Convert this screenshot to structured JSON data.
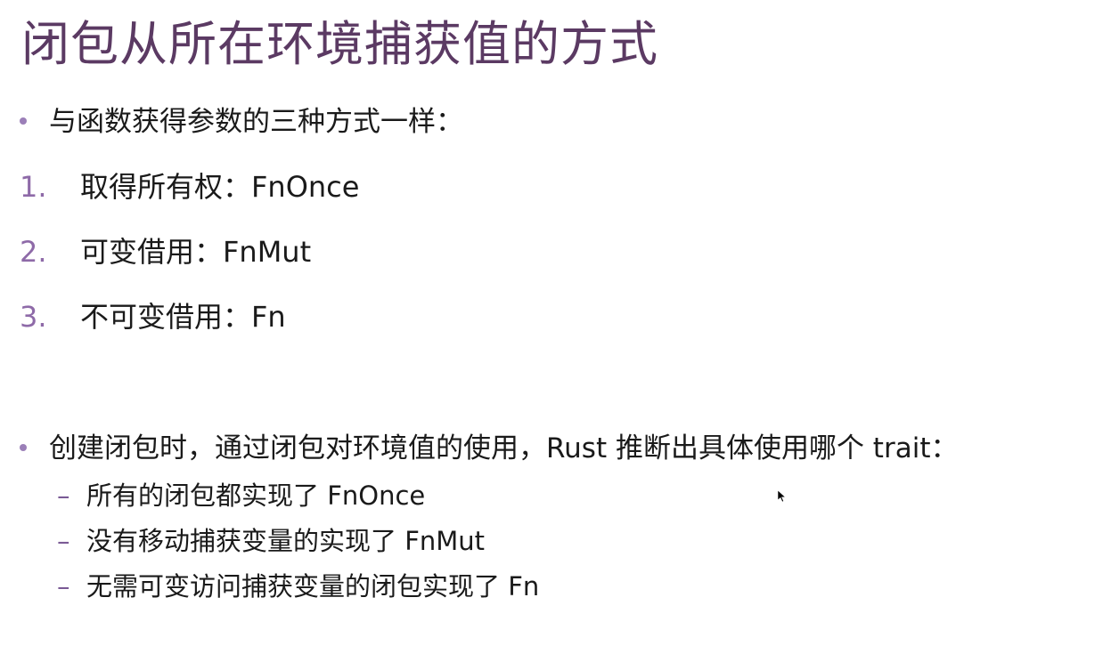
{
  "slide": {
    "title": "闭包从所在环境捕获值的方式",
    "intro_bullet": "与函数获得参数的三种方式一样：",
    "numbered_items": [
      {
        "number": "1.",
        "text": "取得所有权：FnOnce"
      },
      {
        "number": "2.",
        "text": "可变借用：FnMut"
      },
      {
        "number": "3.",
        "text": "不可变借用：Fn"
      }
    ],
    "second_bullet": "创建闭包时，通过闭包对环境值的使用，Rust 推断出具体使用哪个 trait：",
    "sub_items": [
      {
        "marker": "–",
        "text": "所有的闭包都实现了 FnOnce"
      },
      {
        "marker": "–",
        "text": "没有移动捕获变量的实现了 FnMut"
      },
      {
        "marker": "–",
        "text": "无需可变访问捕获变量的闭包实现了 Fn"
      }
    ]
  },
  "colors": {
    "title": "#5b3a63",
    "bullet": "#9b7fb8",
    "number": "#8e6aa8",
    "dash": "#7a5a95",
    "text": "#1a1a1a",
    "background": "#ffffff"
  },
  "icons": {
    "cursor": "mouse-pointer-icon"
  }
}
